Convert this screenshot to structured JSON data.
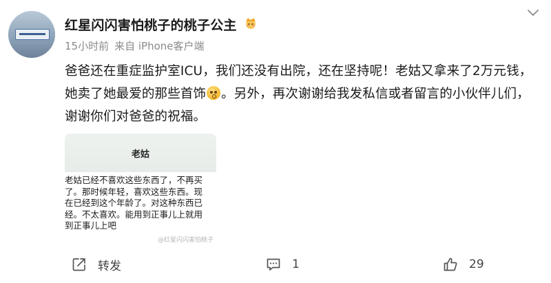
{
  "user": {
    "name": "红星闪闪害怕桃子的桃子公主",
    "badge_icon": "crown-emoji-icon"
  },
  "meta": {
    "time": "15小时前",
    "source": "来自 iPhone客户端"
  },
  "post": {
    "text_before_emoji": "爸爸还在重症监护室ICU，我们还没有出院，还在坚持呢！老姑又拿来了2万元钱，她卖了她最爱的那些首饰",
    "text_after_emoji": "。另外，再次谢谢给我发私信或者留言的小伙伴儿们，谢谢你们对爸爸的祝福。",
    "emoji": "sad-face-emoji"
  },
  "card": {
    "title": "老姑",
    "message": "老姑已经不喜欢这些东西了，不再买了。那时候年轻，喜欢这些东西。现在已经到这个年龄了。对这种东西已经。不太喜欢。能用到正事儿上就用到正事儿上吧",
    "watermark": "@红星闪闪害怕桃子"
  },
  "actions": {
    "repost_label": "转发",
    "comment_count": "1",
    "like_count": "29"
  }
}
